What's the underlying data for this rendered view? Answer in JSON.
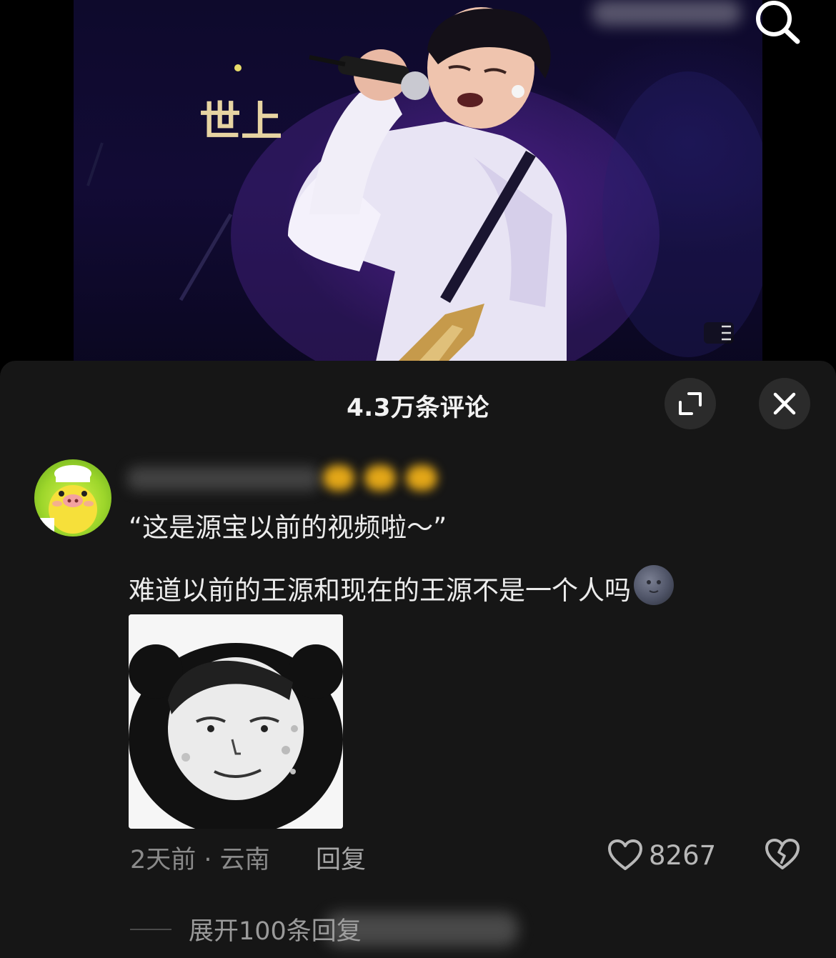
{
  "video": {
    "overlay_logo_text": "世上"
  },
  "comments_sheet": {
    "title": "4.3万条评论"
  },
  "comment": {
    "text_line1": "“这是源宝以前的视频啦～”",
    "text_line2": "难道以前的王源和现在的王源不是一个人吗",
    "time_location": "2天前 · 云南",
    "reply_label": "回复",
    "like_count": "8267",
    "expand_replies": "展开100条回复"
  },
  "icons": {
    "search": "search-icon",
    "menu": "menu-lines-icon",
    "expand": "expand-icon",
    "close": "close-icon",
    "like": "heart-outline-icon",
    "dislike": "broken-heart-icon",
    "emoji": "new-moon-face-emoji"
  },
  "colors": {
    "sheet_background": "#161616",
    "text_primary": "#ececec",
    "text_secondary": "#8a8a8a",
    "button_background": "#2b2b2b"
  }
}
